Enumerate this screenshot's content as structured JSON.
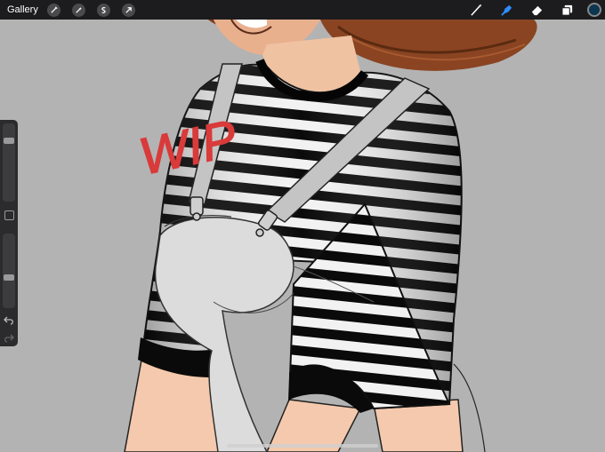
{
  "app": {
    "gallery_label": "Gallery"
  },
  "toolbar_left": {
    "icons": [
      "wrench-icon",
      "magic-wand-icon",
      "selection-icon",
      "transform-arrow-icon"
    ]
  },
  "toolbar_right": {
    "icons": [
      "brush-icon",
      "smudge-icon",
      "eraser-icon",
      "layers-icon"
    ],
    "active_tool": "smudge-icon",
    "current_color": "#0b3550",
    "active_tool_color": "#2f8cff"
  },
  "canvas": {
    "wip_text": "WIP",
    "wip_color": "#d93a3a",
    "background_color": "#b3b3b3"
  },
  "sidebar": {
    "brush_size_level": 0.2,
    "opacity_level": 0.6
  }
}
